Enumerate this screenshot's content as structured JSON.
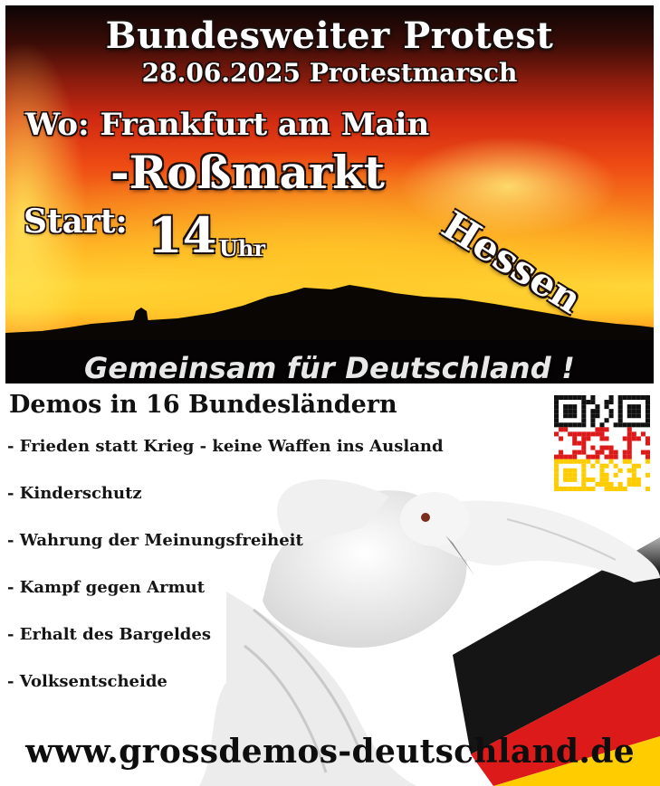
{
  "banner": {
    "title": "Bundesweiter Protest",
    "subtitle": "28.06.2025 Protestmarsch",
    "where": "Wo: Frankfurt am Main",
    "place": "-Roßmarkt",
    "start_label": "Start:",
    "start_hour": "14",
    "start_unit": "Uhr",
    "state": "Hessen",
    "motto": "Gemeinsam für Deutschland !"
  },
  "info": {
    "heading": "Demos in 16 Bundesländern",
    "topics": [
      "- Frieden statt Krieg - keine Waffen ins Ausland",
      "- Kinderschutz",
      "- Wahrung der Meinungsfreiheit",
      "- Kampf gegen Armut",
      "- Erhalt des Bargeldes",
      "- Volksentscheide"
    ]
  },
  "footer": {
    "website": "www.grossdemos-deutschland.de"
  },
  "colors": {
    "flag_black": "#111111",
    "flag_red": "#dd1a1a",
    "flag_gold": "#ffcc00",
    "sky_red": "#d02a12",
    "sky_gold": "#ffd83a"
  },
  "icons": {
    "qr": "qr-code-icon",
    "dove": "dove-image"
  }
}
